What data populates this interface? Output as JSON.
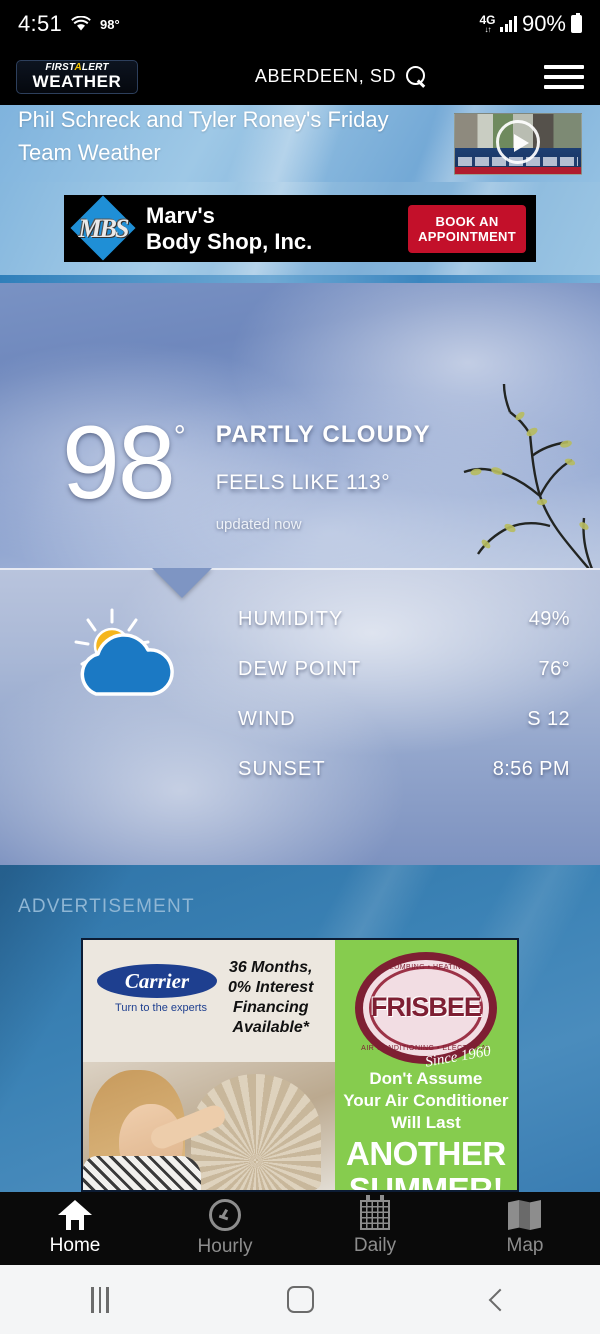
{
  "status_bar": {
    "time": "4:51",
    "wifi_icon": "wifi-icon",
    "temperature": "98°",
    "network": "4G",
    "network_arrows": "↓↑",
    "signal_icon": "signal-bars-icon",
    "battery_percent": "90%",
    "battery_icon": "battery-icon"
  },
  "app_bar": {
    "logo_top": "FIRST",
    "logo_alert": "A",
    "logo_top_rest": "LERT",
    "logo_bottom": "WEATHER",
    "location": "ABERDEEN, SD",
    "search_icon": "search-icon",
    "menu_icon": "hamburger-menu-icon"
  },
  "headline": {
    "text": "Phil Schreck and Tyler Roney's Friday Team Weather",
    "play_icon": "play-button-icon"
  },
  "top_ad": {
    "logo_text": "MBS",
    "title": "Marv's\nBody Shop, Inc.",
    "title_line1": "Marv's",
    "title_line2": "Body Shop, Inc.",
    "button_line1": "BOOK AN",
    "button_line2": "APPOINTMENT",
    "button_color": "#c3102a"
  },
  "current": {
    "temperature": "98",
    "degree": "°",
    "condition": "PARTLY CLOUDY",
    "feels_like": "FEELS LIKE 113°",
    "updated": "updated now",
    "icon": "partly-cloudy-icon"
  },
  "details": [
    {
      "label": "HUMIDITY",
      "value": "49%"
    },
    {
      "label": "DEW POINT",
      "value": "76°"
    },
    {
      "label": "WIND",
      "value": "S 12"
    },
    {
      "label": "SUNSET",
      "value": "8:56 PM"
    }
  ],
  "bottom_ad": {
    "label": "ADVERTISEMENT",
    "carrier_brand": "Carrier",
    "carrier_tagline": "Turn to the experts",
    "offer_line1": "36 Months,",
    "offer_line2": "0% Interest",
    "offer_line3": "Financing",
    "offer_line4": "Available*",
    "frisbee_brand": "FRISBEE",
    "frisbee_top_arc": "PLUMBING • HEATING",
    "frisbee_bottom_arc": "AIR CONDITIONING • ELECTRICAL",
    "frisbee_since": "Since 1960",
    "headline_line1": "Don't Assume",
    "headline_line2": "Your Air Conditioner",
    "headline_line3": "Will Last",
    "big_line1": "ANOTHER",
    "big_line2": "SUMMER!",
    "green_color": "#86cc4e"
  },
  "bottom_nav": [
    {
      "label": "Home",
      "icon": "home-icon",
      "active": true
    },
    {
      "label": "Hourly",
      "icon": "clock-icon",
      "active": false
    },
    {
      "label": "Daily",
      "icon": "calendar-icon",
      "active": false
    },
    {
      "label": "Map",
      "icon": "map-icon",
      "active": false
    }
  ],
  "system_nav": {
    "recents_icon": "recents-icon",
    "home_icon": "system-home-icon",
    "back_icon": "back-icon"
  }
}
